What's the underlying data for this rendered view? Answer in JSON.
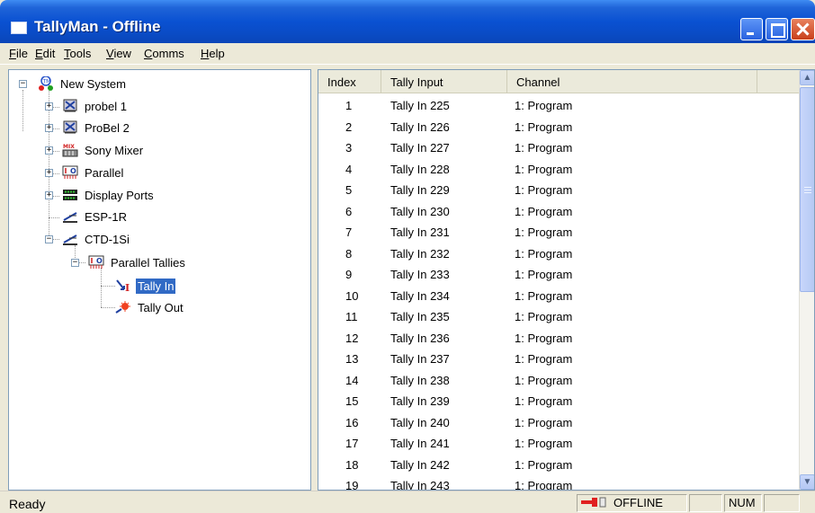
{
  "window": {
    "title": "TallyMan - Offline"
  },
  "menu": [
    "File",
    "Edit",
    "Tools",
    "View",
    "Comms",
    "Help"
  ],
  "tree": {
    "root": "New System",
    "nodes": [
      {
        "label": "probel 1",
        "icon": "probel-router-icon"
      },
      {
        "label": "ProBel 2",
        "icon": "probel-router-icon"
      },
      {
        "label": "Sony Mixer",
        "icon": "mixer-icon"
      },
      {
        "label": "Parallel",
        "icon": "parallel-io-icon"
      },
      {
        "label": "Display Ports",
        "icon": "display-ports-icon"
      },
      {
        "label": "ESP-1R",
        "icon": "esp-device-icon"
      },
      {
        "label": "CTD-1Si",
        "icon": "ctd-device-icon"
      },
      {
        "label": "Parallel Tallies",
        "icon": "parallel-io-icon"
      },
      {
        "label": "Tally In",
        "icon": "tally-in-icon",
        "selected": true
      },
      {
        "label": "Tally Out",
        "icon": "tally-out-icon"
      }
    ]
  },
  "list": {
    "columns": [
      "Index",
      "Tally Input",
      "Channel"
    ],
    "rows": [
      [
        "1",
        "Tally In 225",
        "1: Program"
      ],
      [
        "2",
        "Tally In 226",
        "1: Program"
      ],
      [
        "3",
        "Tally In 227",
        "1: Program"
      ],
      [
        "4",
        "Tally In 228",
        "1: Program"
      ],
      [
        "5",
        "Tally In 229",
        "1: Program"
      ],
      [
        "6",
        "Tally In 230",
        "1: Program"
      ],
      [
        "7",
        "Tally In 231",
        "1: Program"
      ],
      [
        "8",
        "Tally In 232",
        "1: Program"
      ],
      [
        "9",
        "Tally In 233",
        "1: Program"
      ],
      [
        "10",
        "Tally In 234",
        "1: Program"
      ],
      [
        "11",
        "Tally In 235",
        "1: Program"
      ],
      [
        "12",
        "Tally In 236",
        "1: Program"
      ],
      [
        "13",
        "Tally In 237",
        "1: Program"
      ],
      [
        "14",
        "Tally In 238",
        "1: Program"
      ],
      [
        "15",
        "Tally In 239",
        "1: Program"
      ],
      [
        "16",
        "Tally In 240",
        "1: Program"
      ],
      [
        "17",
        "Tally In 241",
        "1: Program"
      ],
      [
        "18",
        "Tally In 242",
        "1: Program"
      ],
      [
        "19",
        "Tally In 243",
        "1: Program"
      ]
    ]
  },
  "status": {
    "message": "Ready",
    "connection": "OFFLINE",
    "num": "NUM"
  },
  "colors": {
    "title_bar": "#0a51d2",
    "selection": "#316ac5",
    "chrome": "#ece9d8"
  }
}
